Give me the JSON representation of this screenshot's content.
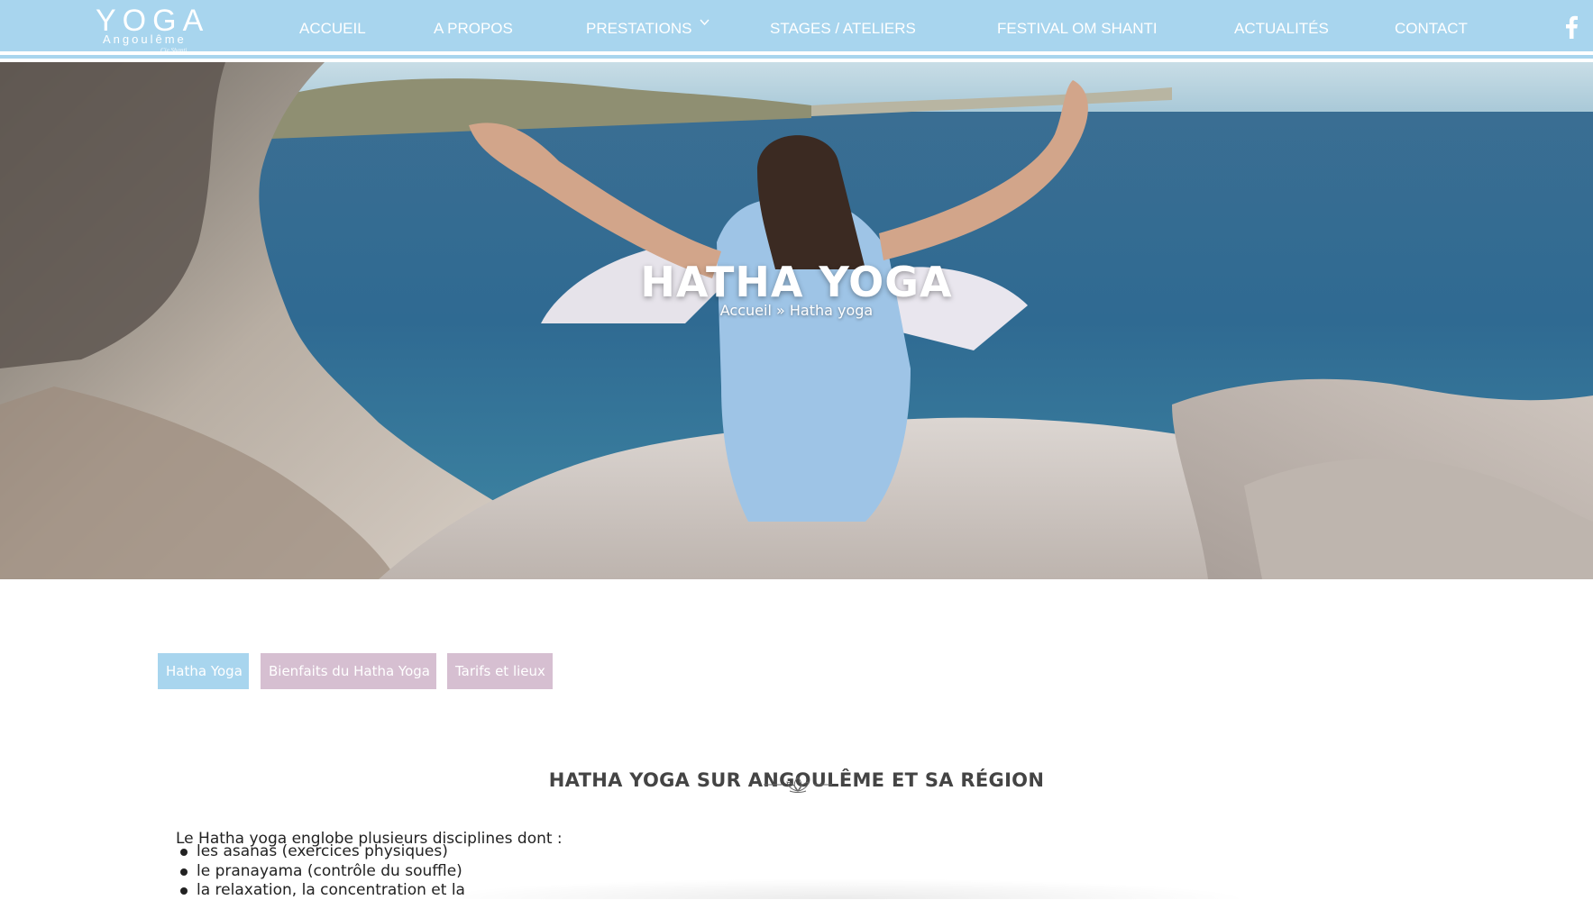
{
  "header": {
    "logo": {
      "main": "YOGA",
      "sub": "Angoulême",
      "tiny": "Cie Shanti"
    },
    "nav": [
      {
        "label": "ACCUEIL"
      },
      {
        "label": "A PROPOS"
      },
      {
        "label": "PRESTATIONS"
      },
      {
        "label": "STAGES / ATELIERS"
      },
      {
        "label": "FESTIVAL OM SHANTI"
      },
      {
        "label": "ACTUALITÉS"
      },
      {
        "label": "CONTACT"
      }
    ],
    "social_icon": "facebook-icon",
    "dropdown_icon": "chevron-down-icon"
  },
  "hero": {
    "title": "HATHA YOGA",
    "breadcrumb": {
      "home": "Accueil",
      "separator": " » ",
      "current": "Hatha yoga"
    }
  },
  "tabs": [
    {
      "label": "Hatha Yoga",
      "active": true
    },
    {
      "label": "Bienfaits du Hatha Yoga",
      "active": false
    },
    {
      "label": "Tarifs et lieux",
      "active": false
    }
  ],
  "section": {
    "title": "HATHA YOGA SUR ANGOULÊME ET SA RÉGION",
    "divider_icon": "lotus-icon",
    "intro": "Le Hatha yoga englobe plusieurs disciplines dont :",
    "items": [
      "les asanas (exercices physiques)",
      "le pranayama (contrôle du souffle)",
      "la relaxation, la concentration et la"
    ]
  },
  "colors": {
    "header_blue": "#a8d5ee",
    "tab_active": "#a8d5ee",
    "tab_inactive": "#d6bfd1",
    "text": "#222222"
  }
}
